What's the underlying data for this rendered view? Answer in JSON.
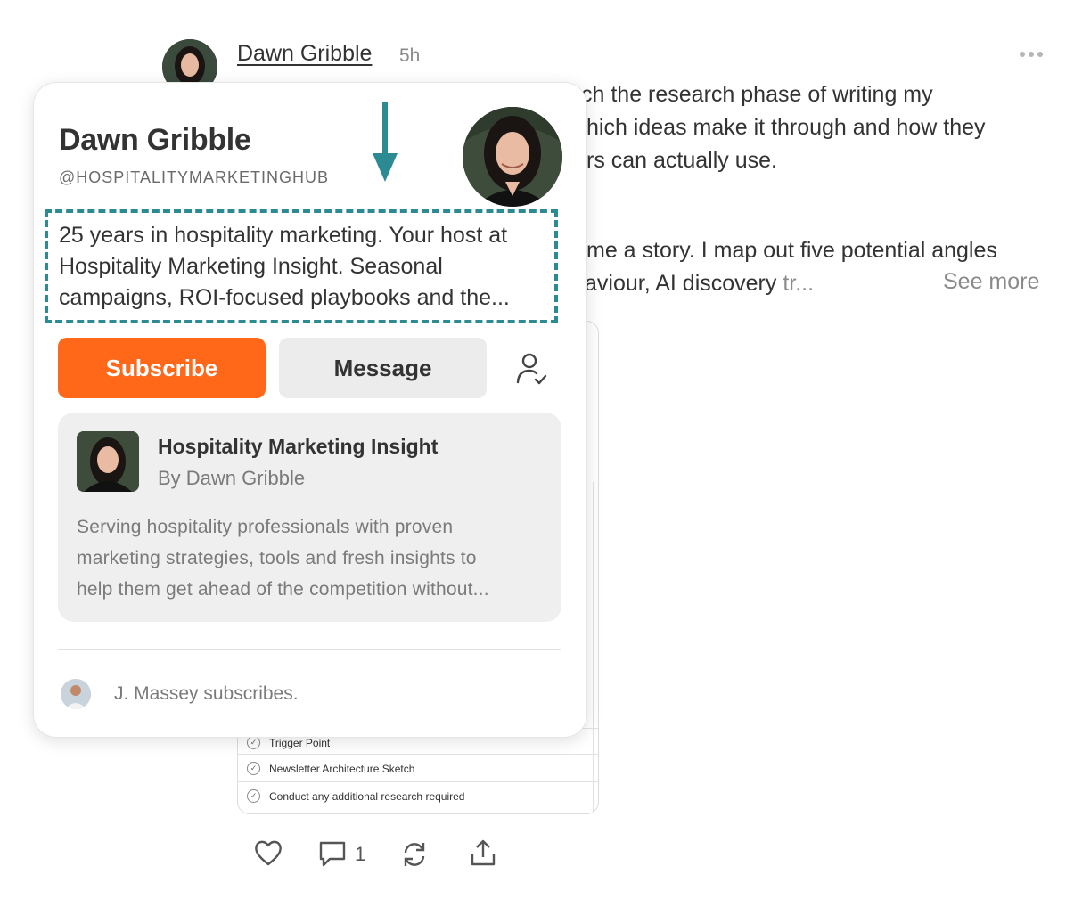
{
  "post": {
    "author": "Dawn Gribble",
    "time": "5h",
    "lines": [
      "ch the research phase of writing my",
      "hich ideas make it through and how they",
      "rs can actually use.",
      "me a story. I map out five potential angles"
    ],
    "line5_main": "aviour, AI discovery",
    "line5_faded": "tr...",
    "see_more": "See more",
    "more_icon": "ellipsis-icon"
  },
  "embed": {
    "rows": [
      "Trigger Point",
      "Newsletter Architecture Sketch",
      "Conduct any additional research required"
    ]
  },
  "actions": {
    "like_icon": "heart-icon",
    "comment_icon": "comment-icon",
    "comment_count": "1",
    "restack_icon": "restack-icon",
    "share_icon": "share-icon"
  },
  "card": {
    "name": "Dawn Gribble",
    "handle": "@HOSPITALITYMARKETINGHUB",
    "bio_lines": [
      "25 years in hospitality marketing. Your host at",
      "Hospitality Marketing Insight. Seasonal",
      "campaigns, ROI-focused playbooks and the..."
    ],
    "subscribe_label": "Subscribe",
    "message_label": "Message",
    "follow_icon": "user-check-icon",
    "publication": {
      "title": "Hospitality Marketing Insight",
      "by": "By Dawn Gribble",
      "desc_lines": [
        "Serving hospitality professionals with proven",
        "marketing strategies, tools and fresh insights to",
        "help them get ahead of the competition without..."
      ]
    },
    "subscriber_note": "J. Massey subscribes."
  },
  "colors": {
    "accent": "#ff6719",
    "annotation": "#2b8a92"
  }
}
